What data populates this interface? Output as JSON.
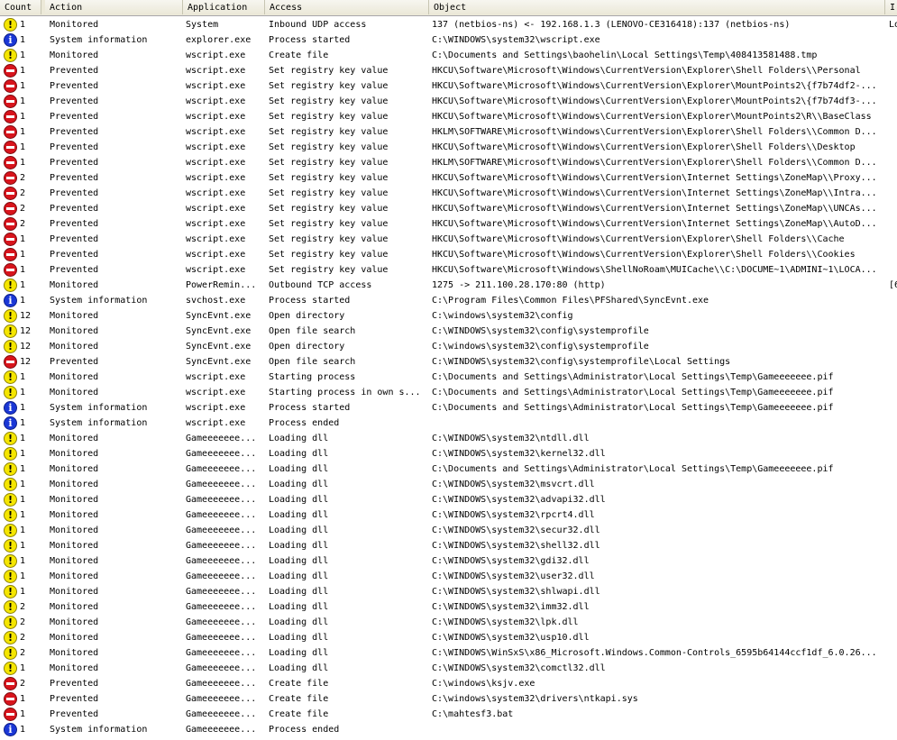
{
  "columns": {
    "count": "Count",
    "action": "Action",
    "application": "Application",
    "access": "Access",
    "object": "Object",
    "extra": "I"
  },
  "rows": [
    {
      "icon": "warning-icon",
      "count": "1",
      "action": "Monitored",
      "app": "System",
      "access": "Inbound UDP access",
      "object": "137 (netbios-ns) <- 192.168.1.3 (LENOVO-CE316418):137 (netbios-ns)",
      "extra": "Lo"
    },
    {
      "icon": "info-icon",
      "count": "1",
      "action": "System information",
      "app": "explorer.exe",
      "access": "Process started",
      "object": "C:\\WINDOWS\\system32\\wscript.exe",
      "extra": ""
    },
    {
      "icon": "warning-icon",
      "count": "1",
      "action": "Monitored",
      "app": "wscript.exe",
      "access": "Create file",
      "object": "C:\\Documents and Settings\\baohelin\\Local Settings\\Temp\\408413581488.tmp",
      "extra": ""
    },
    {
      "icon": "deny-icon",
      "count": "1",
      "action": "Prevented",
      "app": "wscript.exe",
      "access": "Set registry key value",
      "object": "HKCU\\Software\\Microsoft\\Windows\\CurrentVersion\\Explorer\\Shell Folders\\\\Personal",
      "extra": ""
    },
    {
      "icon": "deny-icon",
      "count": "1",
      "action": "Prevented",
      "app": "wscript.exe",
      "access": "Set registry key value",
      "object": "HKCU\\Software\\Microsoft\\Windows\\CurrentVersion\\Explorer\\MountPoints2\\{f7b74df2-...",
      "extra": ""
    },
    {
      "icon": "deny-icon",
      "count": "1",
      "action": "Prevented",
      "app": "wscript.exe",
      "access": "Set registry key value",
      "object": "HKCU\\Software\\Microsoft\\Windows\\CurrentVersion\\Explorer\\MountPoints2\\{f7b74df3-...",
      "extra": ""
    },
    {
      "icon": "deny-icon",
      "count": "1",
      "action": "Prevented",
      "app": "wscript.exe",
      "access": "Set registry key value",
      "object": "HKCU\\Software\\Microsoft\\Windows\\CurrentVersion\\Explorer\\MountPoints2\\R\\\\BaseClass",
      "extra": ""
    },
    {
      "icon": "deny-icon",
      "count": "1",
      "action": "Prevented",
      "app": "wscript.exe",
      "access": "Set registry key value",
      "object": "HKLM\\SOFTWARE\\Microsoft\\Windows\\CurrentVersion\\Explorer\\Shell Folders\\\\Common D...",
      "extra": ""
    },
    {
      "icon": "deny-icon",
      "count": "1",
      "action": "Prevented",
      "app": "wscript.exe",
      "access": "Set registry key value",
      "object": "HKCU\\Software\\Microsoft\\Windows\\CurrentVersion\\Explorer\\Shell Folders\\\\Desktop",
      "extra": ""
    },
    {
      "icon": "deny-icon",
      "count": "1",
      "action": "Prevented",
      "app": "wscript.exe",
      "access": "Set registry key value",
      "object": "HKLM\\SOFTWARE\\Microsoft\\Windows\\CurrentVersion\\Explorer\\Shell Folders\\\\Common D...",
      "extra": ""
    },
    {
      "icon": "deny-icon",
      "count": "2",
      "action": "Prevented",
      "app": "wscript.exe",
      "access": "Set registry key value",
      "object": "HKCU\\Software\\Microsoft\\Windows\\CurrentVersion\\Internet Settings\\ZoneMap\\\\Proxy...",
      "extra": ""
    },
    {
      "icon": "deny-icon",
      "count": "2",
      "action": "Prevented",
      "app": "wscript.exe",
      "access": "Set registry key value",
      "object": "HKCU\\Software\\Microsoft\\Windows\\CurrentVersion\\Internet Settings\\ZoneMap\\\\Intra...",
      "extra": ""
    },
    {
      "icon": "deny-icon",
      "count": "2",
      "action": "Prevented",
      "app": "wscript.exe",
      "access": "Set registry key value",
      "object": "HKCU\\Software\\Microsoft\\Windows\\CurrentVersion\\Internet Settings\\ZoneMap\\\\UNCAs...",
      "extra": ""
    },
    {
      "icon": "deny-icon",
      "count": "2",
      "action": "Prevented",
      "app": "wscript.exe",
      "access": "Set registry key value",
      "object": "HKCU\\Software\\Microsoft\\Windows\\CurrentVersion\\Internet Settings\\ZoneMap\\\\AutoD...",
      "extra": ""
    },
    {
      "icon": "deny-icon",
      "count": "1",
      "action": "Prevented",
      "app": "wscript.exe",
      "access": "Set registry key value",
      "object": "HKCU\\Software\\Microsoft\\Windows\\CurrentVersion\\Explorer\\Shell Folders\\\\Cache",
      "extra": ""
    },
    {
      "icon": "deny-icon",
      "count": "1",
      "action": "Prevented",
      "app": "wscript.exe",
      "access": "Set registry key value",
      "object": "HKCU\\Software\\Microsoft\\Windows\\CurrentVersion\\Explorer\\Shell Folders\\\\Cookies",
      "extra": ""
    },
    {
      "icon": "deny-icon",
      "count": "1",
      "action": "Prevented",
      "app": "wscript.exe",
      "access": "Set registry key value",
      "object": "HKCU\\Software\\Microsoft\\Windows\\ShellNoRoam\\MUICache\\\\C:\\DOCUME~1\\ADMINI~1\\LOCA...",
      "extra": ""
    },
    {
      "icon": "warning-icon",
      "count": "1",
      "action": "Monitored",
      "app": "PowerRemin...",
      "access": "Outbound TCP access",
      "object": "1275 -> 211.100.28.170:80 (http)",
      "extra": "[6"
    },
    {
      "icon": "info-icon",
      "count": "1",
      "action": "System information",
      "app": "svchost.exe",
      "access": "Process started",
      "object": "C:\\Program Files\\Common Files\\PFShared\\SyncEvnt.exe",
      "extra": ""
    },
    {
      "icon": "warning-icon",
      "count": "12",
      "action": "Monitored",
      "app": "SyncEvnt.exe",
      "access": "Open directory",
      "object": "C:\\windows\\system32\\config",
      "extra": ""
    },
    {
      "icon": "warning-icon",
      "count": "12",
      "action": "Monitored",
      "app": "SyncEvnt.exe",
      "access": "Open file search",
      "object": "C:\\WINDOWS\\system32\\config\\systemprofile",
      "extra": ""
    },
    {
      "icon": "warning-icon",
      "count": "12",
      "action": "Monitored",
      "app": "SyncEvnt.exe",
      "access": "Open directory",
      "object": "C:\\windows\\system32\\config\\systemprofile",
      "extra": ""
    },
    {
      "icon": "deny-icon",
      "count": "12",
      "action": "Prevented",
      "app": "SyncEvnt.exe",
      "access": "Open file search",
      "object": "C:\\WINDOWS\\system32\\config\\systemprofile\\Local Settings",
      "extra": ""
    },
    {
      "icon": "warning-icon",
      "count": "1",
      "action": "Monitored",
      "app": "wscript.exe",
      "access": "Starting process",
      "object": "C:\\Documents and Settings\\Administrator\\Local Settings\\Temp\\Gameeeeeee.pif",
      "extra": ""
    },
    {
      "icon": "warning-icon",
      "count": "1",
      "action": "Monitored",
      "app": "wscript.exe",
      "access": "Starting process in own s...",
      "object": "C:\\Documents and Settings\\Administrator\\Local Settings\\Temp\\Gameeeeeee.pif",
      "extra": ""
    },
    {
      "icon": "info-icon",
      "count": "1",
      "action": "System information",
      "app": "wscript.exe",
      "access": "Process started",
      "object": "C:\\Documents and Settings\\Administrator\\Local Settings\\Temp\\Gameeeeeee.pif",
      "extra": ""
    },
    {
      "icon": "info-icon",
      "count": "1",
      "action": "System information",
      "app": "wscript.exe",
      "access": "Process ended",
      "object": "",
      "extra": ""
    },
    {
      "icon": "warning-icon",
      "count": "1",
      "action": "Monitored",
      "app": "Gameeeeeee...",
      "access": "Loading dll",
      "object": "C:\\WINDOWS\\system32\\ntdll.dll",
      "extra": ""
    },
    {
      "icon": "warning-icon",
      "count": "1",
      "action": "Monitored",
      "app": "Gameeeeeee...",
      "access": "Loading dll",
      "object": "C:\\WINDOWS\\system32\\kernel32.dll",
      "extra": ""
    },
    {
      "icon": "warning-icon",
      "count": "1",
      "action": "Monitored",
      "app": "Gameeeeeee...",
      "access": "Loading dll",
      "object": "C:\\Documents and Settings\\Administrator\\Local Settings\\Temp\\Gameeeeeee.pif",
      "extra": ""
    },
    {
      "icon": "warning-icon",
      "count": "1",
      "action": "Monitored",
      "app": "Gameeeeeee...",
      "access": "Loading dll",
      "object": "C:\\WINDOWS\\system32\\msvcrt.dll",
      "extra": ""
    },
    {
      "icon": "warning-icon",
      "count": "1",
      "action": "Monitored",
      "app": "Gameeeeeee...",
      "access": "Loading dll",
      "object": "C:\\WINDOWS\\system32\\advapi32.dll",
      "extra": ""
    },
    {
      "icon": "warning-icon",
      "count": "1",
      "action": "Monitored",
      "app": "Gameeeeeee...",
      "access": "Loading dll",
      "object": "C:\\WINDOWS\\system32\\rpcrt4.dll",
      "extra": ""
    },
    {
      "icon": "warning-icon",
      "count": "1",
      "action": "Monitored",
      "app": "Gameeeeeee...",
      "access": "Loading dll",
      "object": "C:\\WINDOWS\\system32\\secur32.dll",
      "extra": ""
    },
    {
      "icon": "warning-icon",
      "count": "1",
      "action": "Monitored",
      "app": "Gameeeeeee...",
      "access": "Loading dll",
      "object": "C:\\WINDOWS\\system32\\shell32.dll",
      "extra": ""
    },
    {
      "icon": "warning-icon",
      "count": "1",
      "action": "Monitored",
      "app": "Gameeeeeee...",
      "access": "Loading dll",
      "object": "C:\\WINDOWS\\system32\\gdi32.dll",
      "extra": ""
    },
    {
      "icon": "warning-icon",
      "count": "1",
      "action": "Monitored",
      "app": "Gameeeeeee...",
      "access": "Loading dll",
      "object": "C:\\WINDOWS\\system32\\user32.dll",
      "extra": ""
    },
    {
      "icon": "warning-icon",
      "count": "1",
      "action": "Monitored",
      "app": "Gameeeeeee...",
      "access": "Loading dll",
      "object": "C:\\WINDOWS\\system32\\shlwapi.dll",
      "extra": ""
    },
    {
      "icon": "warning-icon",
      "count": "2",
      "action": "Monitored",
      "app": "Gameeeeeee...",
      "access": "Loading dll",
      "object": "C:\\WINDOWS\\system32\\imm32.dll",
      "extra": ""
    },
    {
      "icon": "warning-icon",
      "count": "2",
      "action": "Monitored",
      "app": "Gameeeeeee...",
      "access": "Loading dll",
      "object": "C:\\WINDOWS\\system32\\lpk.dll",
      "extra": ""
    },
    {
      "icon": "warning-icon",
      "count": "2",
      "action": "Monitored",
      "app": "Gameeeeeee...",
      "access": "Loading dll",
      "object": "C:\\WINDOWS\\system32\\usp10.dll",
      "extra": ""
    },
    {
      "icon": "warning-icon",
      "count": "2",
      "action": "Monitored",
      "app": "Gameeeeeee...",
      "access": "Loading dll",
      "object": "C:\\WINDOWS\\WinSxS\\x86_Microsoft.Windows.Common-Controls_6595b64144ccf1df_6.0.26...",
      "extra": ""
    },
    {
      "icon": "warning-icon",
      "count": "1",
      "action": "Monitored",
      "app": "Gameeeeeee...",
      "access": "Loading dll",
      "object": "C:\\WINDOWS\\system32\\comctl32.dll",
      "extra": ""
    },
    {
      "icon": "deny-icon",
      "count": "2",
      "action": "Prevented",
      "app": "Gameeeeeee...",
      "access": "Create file",
      "object": "C:\\windows\\ksjv.exe",
      "extra": ""
    },
    {
      "icon": "deny-icon",
      "count": "1",
      "action": "Prevented",
      "app": "Gameeeeeee...",
      "access": "Create file",
      "object": "C:\\windows\\system32\\drivers\\ntkapi.sys",
      "extra": ""
    },
    {
      "icon": "deny-icon",
      "count": "1",
      "action": "Prevented",
      "app": "Gameeeeeee...",
      "access": "Create file",
      "object": "C:\\mahtesf3.bat",
      "extra": ""
    },
    {
      "icon": "info-icon",
      "count": "1",
      "action": "System information",
      "app": "Gameeeeeee...",
      "access": "Process ended",
      "object": "",
      "extra": ""
    }
  ]
}
